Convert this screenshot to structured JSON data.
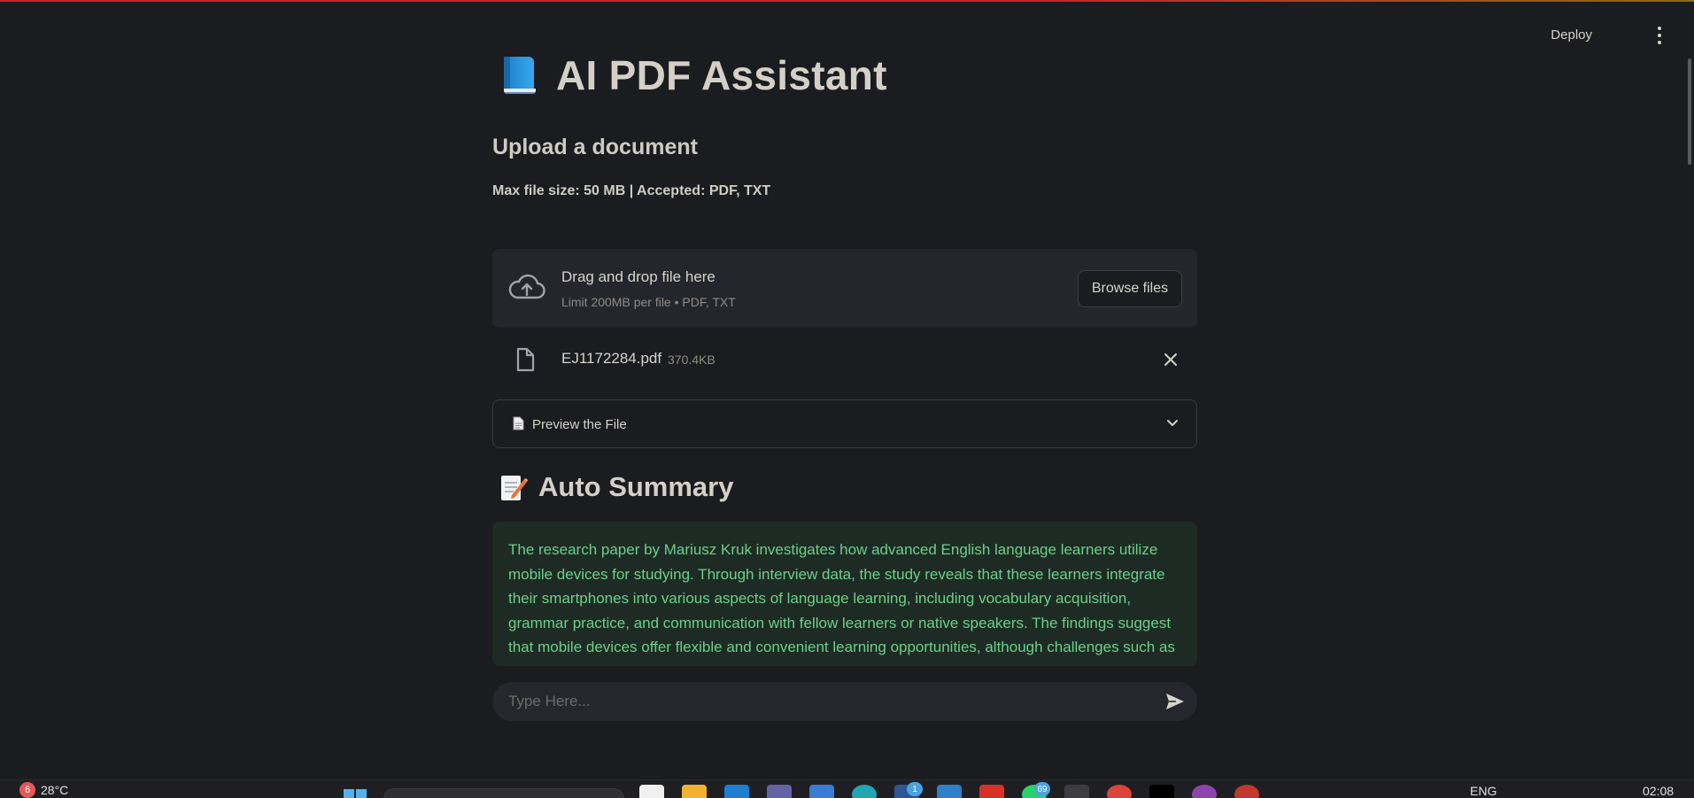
{
  "header": {
    "deploy_label": "Deploy"
  },
  "main": {
    "title": "AI PDF Assistant",
    "upload_subheader": "Upload a document",
    "upload_caption": "Max file size: 50 MB | Accepted: PDF, TXT",
    "dropzone": {
      "title": "Drag and drop file here",
      "limits": "Limit 200MB per file • PDF, TXT",
      "browse_label": "Browse files"
    },
    "uploaded_file": {
      "name": "EJ1172284.pdf",
      "size": "370.4KB"
    },
    "preview_expander_label": "Preview the File",
    "summary_title": "Auto Summary",
    "summary_text": "The research paper by Mariusz Kruk investigates how advanced English language learners utilize mobile devices for studying. Through interview data, the study reveals that these learners integrate their smartphones into various aspects of language learning, including vocabulary acquisition, grammar practice, and communication with fellow learners or native speakers. The findings suggest that mobile devices offer flexible and convenient learning opportunities, although challenges such as distractions and limited screen size are also highlighted by participants.",
    "chat_placeholder": "Type Here..."
  },
  "taskbar": {
    "weather_badge": "6",
    "temperature": "28°C",
    "app_badge_1": "1",
    "app_badge_69": "69",
    "language": "ENG",
    "time": "02:08"
  },
  "colors": {
    "background": "#1b1c1f",
    "summary_bg": "#1e2b24",
    "summary_text": "#6ccf8b",
    "dropzone_bg": "#25262b"
  },
  "icons": [
    "book-icon",
    "cloud-upload-icon",
    "file-icon",
    "close-icon",
    "document-icon",
    "chevron-down-icon",
    "memo-icon",
    "send-icon",
    "menu-dots-icon"
  ]
}
